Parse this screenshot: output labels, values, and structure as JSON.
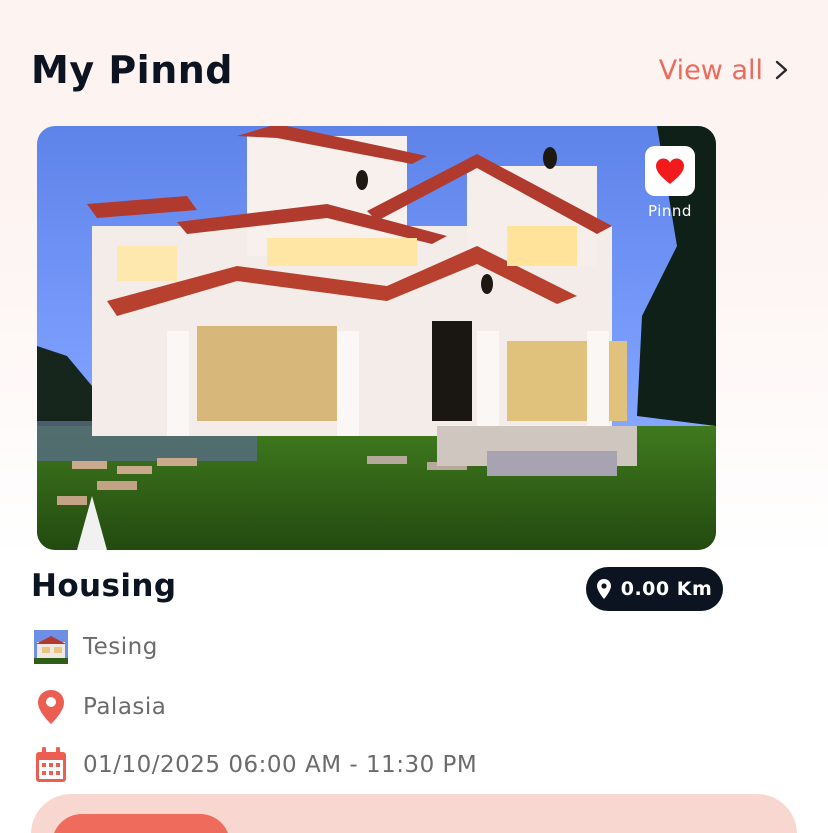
{
  "header": {
    "title": "My Pinnd",
    "view_all": "View all"
  },
  "card": {
    "favorite_label": "Pinnd",
    "title": "Housing",
    "distance": "0.00 Km",
    "organizer": "Tesing",
    "location": "Palasia",
    "datetime": "01/10/2025 06:00 AM - 11:30 PM"
  },
  "colors": {
    "accent": "#ea6a5c",
    "dark": "#0b1420",
    "muted": "#6b6b6b",
    "bar": "#f9d7d1"
  },
  "icons": [
    "chevron-right-icon",
    "heart-icon",
    "location-pin-icon",
    "calendar-icon"
  ]
}
